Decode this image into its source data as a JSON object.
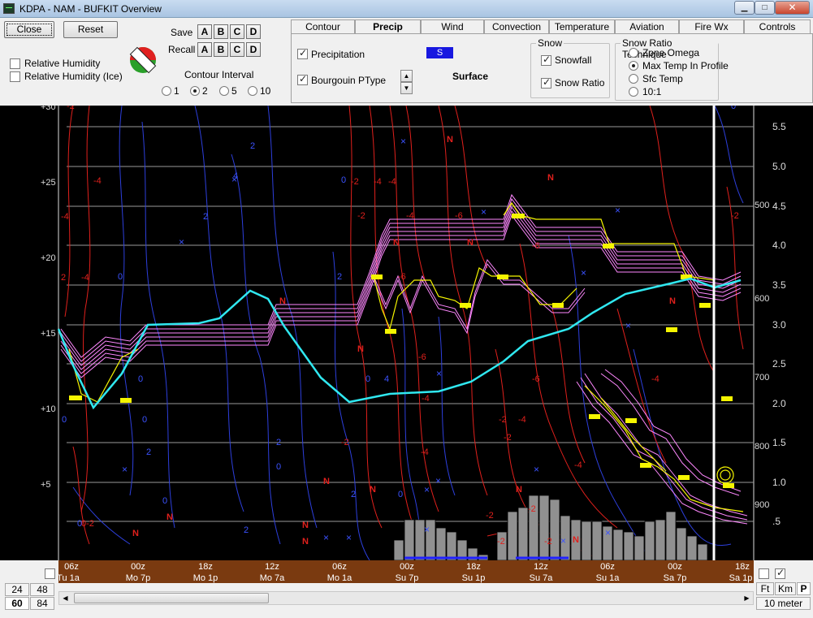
{
  "window": {
    "title": "KDPA - NAM - BUFKIT Overview",
    "minimize": "▁",
    "maximize": "□",
    "close": "✕"
  },
  "controls": {
    "close_label": "Close",
    "reset_label": "Reset",
    "save_label": "Save",
    "recall_label": "Recall",
    "slots": [
      "A",
      "B",
      "C",
      "D"
    ],
    "relative_humidity_label": "Relative Humidity",
    "relative_humidity_ice_label": "Relative Humidity (Ice)",
    "contour_interval_label": "Contour Interval",
    "contour_options": [
      "1",
      "2",
      "5",
      "10"
    ],
    "contour_selected": "2"
  },
  "tabs": [
    "Contour",
    "Precip",
    "Wind",
    "Convection",
    "Temperature",
    "Aviation",
    "Fire Wx",
    "Controls"
  ],
  "active_tab": "Precip",
  "precip": {
    "precipitation_label": "Precipitation",
    "precip_type_code": "S",
    "bourgouin_label": "Bourgouin PType",
    "level_label": "Surface",
    "snow_group": "Snow",
    "snowfall_label": "Snowfall",
    "snow_ratio_label": "Snow Ratio",
    "technique_group": "Snow Ratio Technique",
    "techniques": [
      "Zone Omega",
      "Max Temp In Profile",
      "Sfc Temp",
      "10:1"
    ],
    "technique_selected": "Max Temp In Profile"
  },
  "plot": {
    "left_ticks": [
      "+30",
      "+25",
      "+20",
      "+15",
      "+10",
      "+5"
    ],
    "right_ticks": [
      "5.5",
      "5.0",
      "4.5",
      "4.0",
      "3.5",
      "3.0",
      "2.5",
      "2.0",
      "1.5",
      "1.0",
      ".5"
    ],
    "pressure_labels": [
      "500",
      "600",
      "700",
      "800",
      "900"
    ],
    "colors": {
      "rh": "#2d3fdc",
      "temp": "#e0201c",
      "precip_type": "#ff88ff",
      "freezing": "#f5f500",
      "trace": "#30e8f0",
      "bars": "#909090"
    }
  },
  "timeline": {
    "hours": [
      "06z",
      "00z",
      "18z",
      "12z",
      "06z",
      "00z",
      "18z",
      "12z",
      "06z",
      "00z",
      "18z"
    ],
    "days": [
      "Tu 1a",
      "Mo 7p",
      "Mo 1p",
      "Mo 7a",
      "Mo 1a",
      "Su 7p",
      "Su 1p",
      "Su 7a",
      "Su 1a",
      "Sa 7p",
      "Sa 1p"
    ]
  },
  "bottom": {
    "hour_options": [
      "24",
      "48",
      "60",
      "84"
    ],
    "hour_selected": "60",
    "units": [
      "Ft",
      "Km",
      "P"
    ],
    "level_label": "10 meter"
  }
}
